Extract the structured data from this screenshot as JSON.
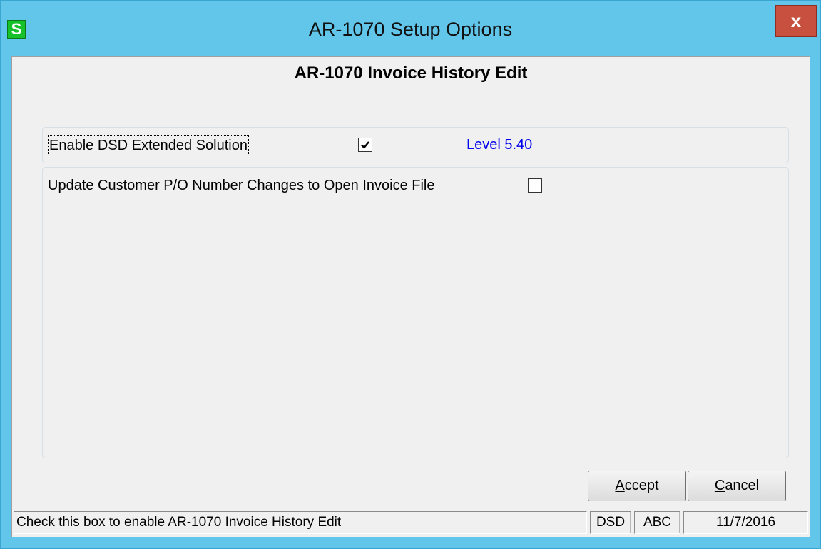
{
  "window": {
    "title": "AR-1070 Setup Options",
    "icon_letter": "S",
    "close_glyph": "x"
  },
  "dialog": {
    "heading": "AR-1070 Invoice History Edit",
    "enable_label": "Enable DSD Extended Solution",
    "enable_checked": true,
    "level_label": "Level",
    "level_value": "5.40",
    "update_label": "Update Customer P/O Number Changes to Open Invoice File",
    "update_checked": false
  },
  "buttons": {
    "accept_hotkey": "A",
    "accept_rest": "ccept",
    "cancel_hotkey": "C",
    "cancel_rest": "ancel"
  },
  "statusbar": {
    "message": "Check this box to enable AR-1070 Invoice History Edit",
    "field1": "DSD",
    "field2": "ABC",
    "date": "11/7/2016"
  },
  "colors": {
    "title_bar": "#62c6ea",
    "close_button": "#c7503f",
    "level_text": "#0000ee",
    "app_icon": "#17c12a"
  },
  "icons": {
    "app": "sage-s-icon",
    "close": "close-icon",
    "check": "checkmark-icon"
  }
}
